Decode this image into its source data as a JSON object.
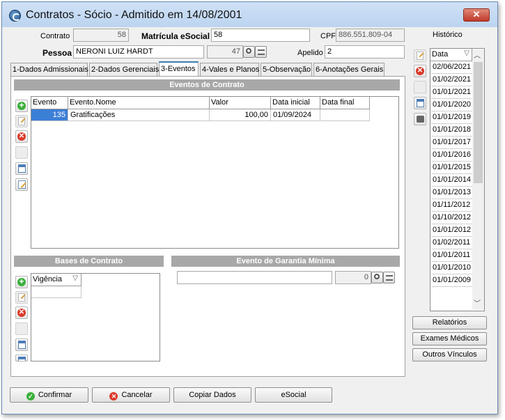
{
  "window": {
    "title": "Contratos - Sócio - Admitido em 14/08/2001",
    "close": "✕"
  },
  "header": {
    "contrato_label": "Contrato",
    "contrato_value": "58",
    "matricula_label": "Matrícula eSocial",
    "matricula_value": "58",
    "cpf_label": "CPF",
    "cpf_value": "886.551.809-04",
    "pessoa_label": "Pessoa",
    "pessoa_value": "NERONI LUIZ HARDT",
    "pessoa_code": "47",
    "apelido_label": "Apelido",
    "apelido_value": "2"
  },
  "tabs": [
    {
      "label": "1-Dados Admissionais"
    },
    {
      "label": "2-Dados Gerenciais"
    },
    {
      "label": "3-Eventos"
    },
    {
      "label": "4-Vales e Planos"
    },
    {
      "label": "5-Observação"
    },
    {
      "label": "6-Anotações Gerais"
    }
  ],
  "eventos": {
    "title": "Eventos de Contrato",
    "columns": [
      "Evento",
      "Evento.Nome",
      "Valor",
      "Data inicial",
      "Data final"
    ],
    "rows": [
      {
        "evento": "135",
        "nome": "Gratificações",
        "valor": "100,00",
        "data_inicial": "01/09/2024",
        "data_final": ""
      }
    ]
  },
  "bases": {
    "title": "Bases de Contrato",
    "column": "Vigência",
    "sort_glyph": "▽"
  },
  "garantia": {
    "title": "Evento de Garantia Mínima",
    "field_value": "",
    "code": "0"
  },
  "historico": {
    "label": "Histórico",
    "column": "Data",
    "sort_glyph": "▽",
    "rows": [
      "02/06/2021",
      "01/02/2021",
      "01/01/2021",
      "01/01/2020",
      "01/01/2019",
      "01/01/2018",
      "01/01/2017",
      "01/01/2016",
      "01/01/2015",
      "01/01/2014",
      "01/01/2013",
      "01/11/2012",
      "01/10/2012",
      "01/01/2012",
      "01/02/2011",
      "01/01/2011",
      "01/01/2010",
      "01/01/2009"
    ],
    "scroll_up": "︿",
    "scroll_down": "﹀"
  },
  "side_buttons": {
    "relatorios": "Relatórios",
    "exames": "Exames Médicos",
    "vinculos": "Outros Vínculos"
  },
  "footer": {
    "confirmar": "Confirmar",
    "cancelar": "Cancelar",
    "copiar": "Copiar Dados",
    "esocial": "eSocial"
  },
  "icons": {
    "confirm_icon": "✓",
    "cancel_icon": "✕"
  },
  "colors": {
    "selection": "#3c7fd6",
    "section_header": "#a8a8a8",
    "tab_accent": "#3c7fb1"
  }
}
